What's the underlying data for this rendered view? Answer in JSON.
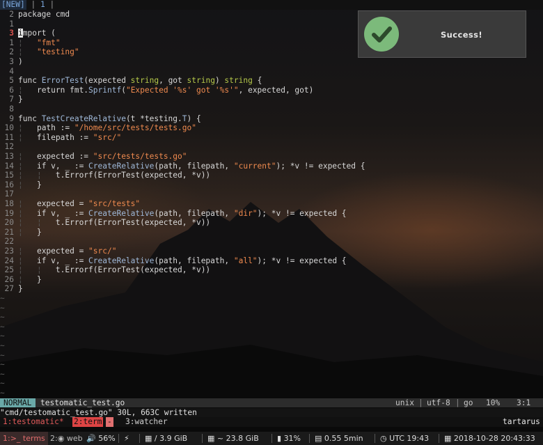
{
  "tabline": {
    "new_label": "[NEW]",
    "sep1": "|",
    "tab_num": "1",
    "sep2": "|"
  },
  "editor": {
    "lines": [
      {
        "num": "2",
        "current": false
      },
      {
        "num": "1",
        "current": false
      },
      {
        "num": "3",
        "current": true
      },
      {
        "num": "1",
        "current": false
      },
      {
        "num": "2",
        "current": false
      },
      {
        "num": "3",
        "current": false
      },
      {
        "num": "4",
        "current": false
      },
      {
        "num": "5",
        "current": false
      },
      {
        "num": "6",
        "current": false
      },
      {
        "num": "7",
        "current": false
      },
      {
        "num": "8",
        "current": false
      },
      {
        "num": "9",
        "current": false
      },
      {
        "num": "10",
        "current": false
      },
      {
        "num": "11",
        "current": false
      },
      {
        "num": "12",
        "current": false
      },
      {
        "num": "13",
        "current": false
      },
      {
        "num": "14",
        "current": false
      },
      {
        "num": "15",
        "current": false
      },
      {
        "num": "16",
        "current": false
      },
      {
        "num": "17",
        "current": false
      },
      {
        "num": "18",
        "current": false
      },
      {
        "num": "19",
        "current": false
      },
      {
        "num": "20",
        "current": false
      },
      {
        "num": "21",
        "current": false
      },
      {
        "num": "22",
        "current": false
      },
      {
        "num": "23",
        "current": false
      },
      {
        "num": "24",
        "current": false
      },
      {
        "num": "25",
        "current": false
      },
      {
        "num": "26",
        "current": false
      },
      {
        "num": "27",
        "current": false
      }
    ],
    "code": {
      "l0_a": "package ",
      "l0_b": "cmd",
      "l2_cursor": "i",
      "l2_rest": "mport (",
      "l3": "\"fmt\"",
      "l4": "\"testing\"",
      "l5": ")",
      "l7_a": "func ",
      "l7_fn": "ErrorTest",
      "l7_b": "(expected ",
      "l7_t1": "string",
      "l7_c": ", got ",
      "l7_t2": "string",
      "l7_d": ") ",
      "l7_t3": "string",
      "l7_e": " {",
      "l8_a": "return fmt.",
      "l8_fn": "Sprintf",
      "l8_b": "(",
      "l8_s": "\"Expected '%s' got '%s'\"",
      "l8_c": ", expected, got)",
      "l9": "}",
      "l11_a": "func ",
      "l11_fn": "TestCreateRelative",
      "l11_b": "(t *testing.",
      "l11_t": "T",
      "l11_c": ") {",
      "l12_a": "path := ",
      "l12_s": "\"/home/src/tests/tests.go\"",
      "l13_a": "filepath := ",
      "l13_s": "\"src/\"",
      "l15_a": "expected := ",
      "l15_s": "\"src/tests/tests.go\"",
      "l16_a": "if v, _ := ",
      "l16_fn": "CreateRelative",
      "l16_b": "(path, filepath, ",
      "l16_s": "\"current\"",
      "l16_c": "); *v != expected {",
      "l17": "t.Errorf(ErrorTest(expected, *v))",
      "l18": "}",
      "l20_a": "expected = ",
      "l20_s": "\"src/tests\"",
      "l21_a": "if v, _ := ",
      "l21_fn": "CreateRelative",
      "l21_b": "(path, filepath, ",
      "l21_s": "\"dir\"",
      "l21_c": "); *v != expected {",
      "l22": "t.Errorf(ErrorTest(expected, *v))",
      "l23": "}",
      "l25_a": "expected = ",
      "l25_s": "\"src/\"",
      "l26_a": "if v, _ := ",
      "l26_fn": "CreateRelative",
      "l26_b": "(path, filepath, ",
      "l26_s": "\"all\"",
      "l26_c": "); *v != expected {",
      "l27": "t.Errorf(ErrorTest(expected, *v))",
      "l28": "}",
      "l29": "}"
    },
    "tilde": "~",
    "tilde_count": 11
  },
  "notification": {
    "text": "Success!",
    "icon": "checkmark-icon"
  },
  "statusline": {
    "mode": "NORMAL",
    "filename": "testomatic_test.go",
    "format": "unix",
    "sep": "|",
    "encoding": "utf-8",
    "filetype": "go",
    "percent": "10%",
    "position": "3:1"
  },
  "message": "\"cmd/testomatic_test.go\" 30L, 663C written",
  "tmux": {
    "win1": "1:testomatic*",
    "win2": "2:term",
    "win2_flag": "-",
    "win3": "3:watcher",
    "host": "tartarus"
  },
  "bar": {
    "ws1": "1:>_ terms",
    "ws2": "2:",
    "ws2_label": "web",
    "volume": "56%",
    "disk_root": "/ 3.9 GiB",
    "disk_home": "~ 23.8 GiB",
    "battery": "31%",
    "load": "0.55 5min",
    "clock_utc": "UTC 19:43",
    "date": "2018-10-28 20:43:33"
  },
  "colors": {
    "accent": "#6aa9a8",
    "success": "#7cba7b",
    "error": "#d9534f",
    "string": "#ef8a4f",
    "type": "#b5c94a"
  }
}
